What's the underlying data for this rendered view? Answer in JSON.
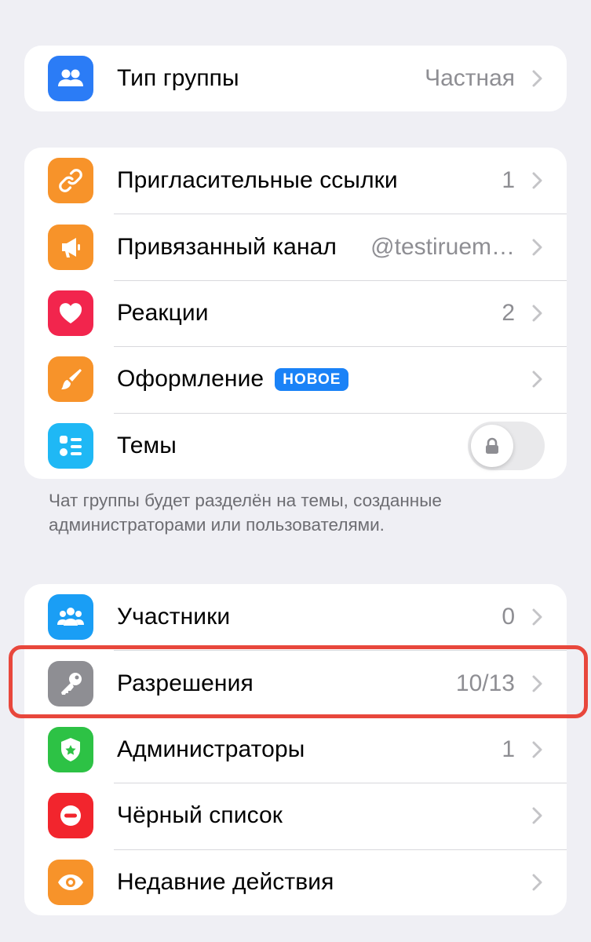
{
  "colors": {
    "background": "#efeff4",
    "card": "#ffffff",
    "secondary_text": "#8e8e93",
    "highlight": "#e8473c",
    "badge": "#1a82f7"
  },
  "group_type": {
    "label": "Тип группы",
    "value": "Частная",
    "icon": "people-icon"
  },
  "settings": {
    "invite_links": {
      "label": "Пригласительные ссылки",
      "value": "1",
      "icon": "link-icon"
    },
    "linked_channel": {
      "label": "Привязанный канал",
      "value": "@testiruem…",
      "icon": "megaphone-icon"
    },
    "reactions": {
      "label": "Реакции",
      "value": "2",
      "icon": "heart-icon"
    },
    "appearance": {
      "label": "Оформление",
      "badge": "НОВОЕ",
      "icon": "brush-icon"
    },
    "topics": {
      "label": "Темы",
      "toggle_on": false,
      "locked": true,
      "icon": "topics-list-icon"
    }
  },
  "topics_footer": "Чат группы будет разделён на темы, созданные администраторами или пользователями.",
  "members_section": {
    "members": {
      "label": "Участники",
      "value": "0",
      "icon": "members-icon"
    },
    "permissions": {
      "label": "Разрешения",
      "value": "10/13",
      "icon": "key-icon",
      "highlighted": true
    },
    "admins": {
      "label": "Администраторы",
      "value": "1",
      "icon": "badge-star-icon"
    },
    "blacklist": {
      "label": "Чёрный список",
      "icon": "minus-circle-icon"
    },
    "recent_actions": {
      "label": "Недавние действия",
      "icon": "eye-icon"
    }
  }
}
